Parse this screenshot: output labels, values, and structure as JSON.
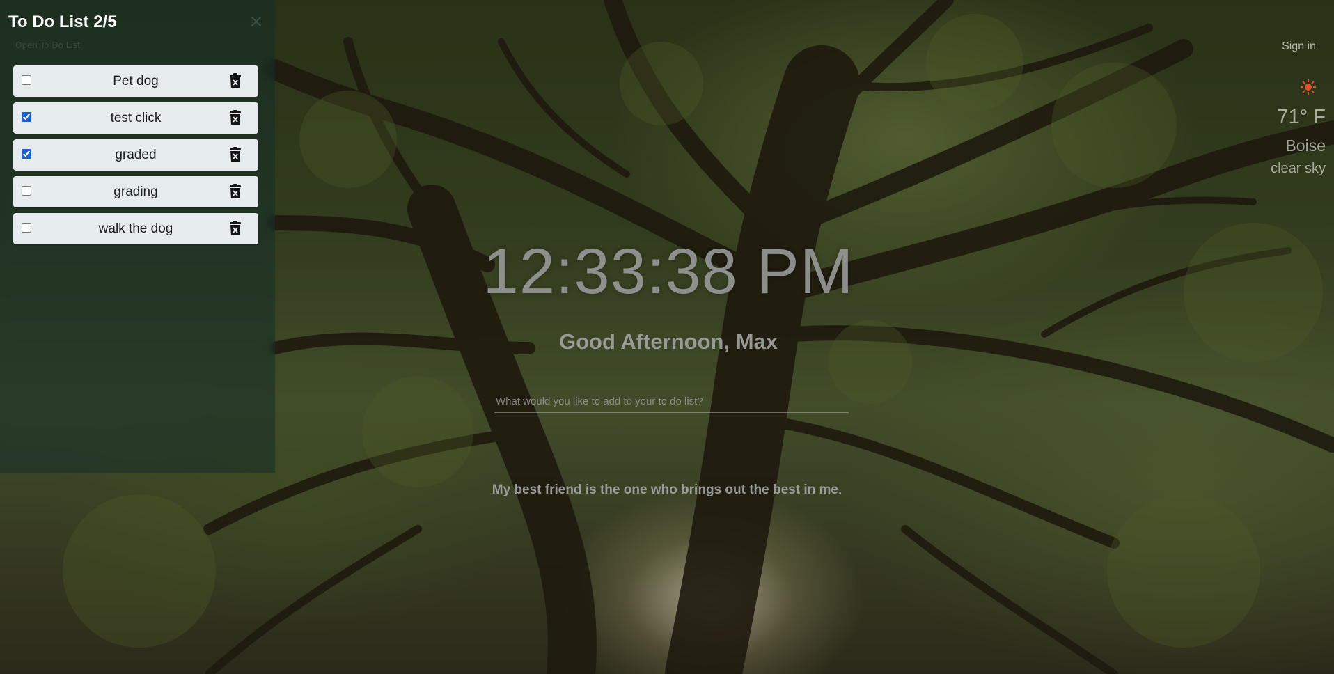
{
  "todo": {
    "title": "To Do List 2/5",
    "close_symbol": "×",
    "subtitle": "Open To Do List",
    "items": [
      {
        "label": "Pet dog",
        "checked": false
      },
      {
        "label": "test click",
        "checked": true
      },
      {
        "label": "graded",
        "checked": true
      },
      {
        "label": "grading",
        "checked": false
      },
      {
        "label": "walk the dog",
        "checked": false
      }
    ],
    "delete_icon": "trash-x-icon"
  },
  "header": {
    "sign_in": "Sign in"
  },
  "weather": {
    "icon": "sun-icon",
    "temperature": "71° F",
    "city": "Boise",
    "description": "clear sky"
  },
  "center": {
    "clock": "12:33:38 PM",
    "greeting": "Good Afternoon, Max",
    "input_placeholder": "What would you like to add to your to do list?",
    "quote": "My best friend is the one who brings out the best in me."
  },
  "colors": {
    "panel_bg": "#142d28",
    "item_bg": "#e6ebee",
    "checkbox_accent": "#1a5fd1",
    "sun_color": "#e0502a"
  }
}
